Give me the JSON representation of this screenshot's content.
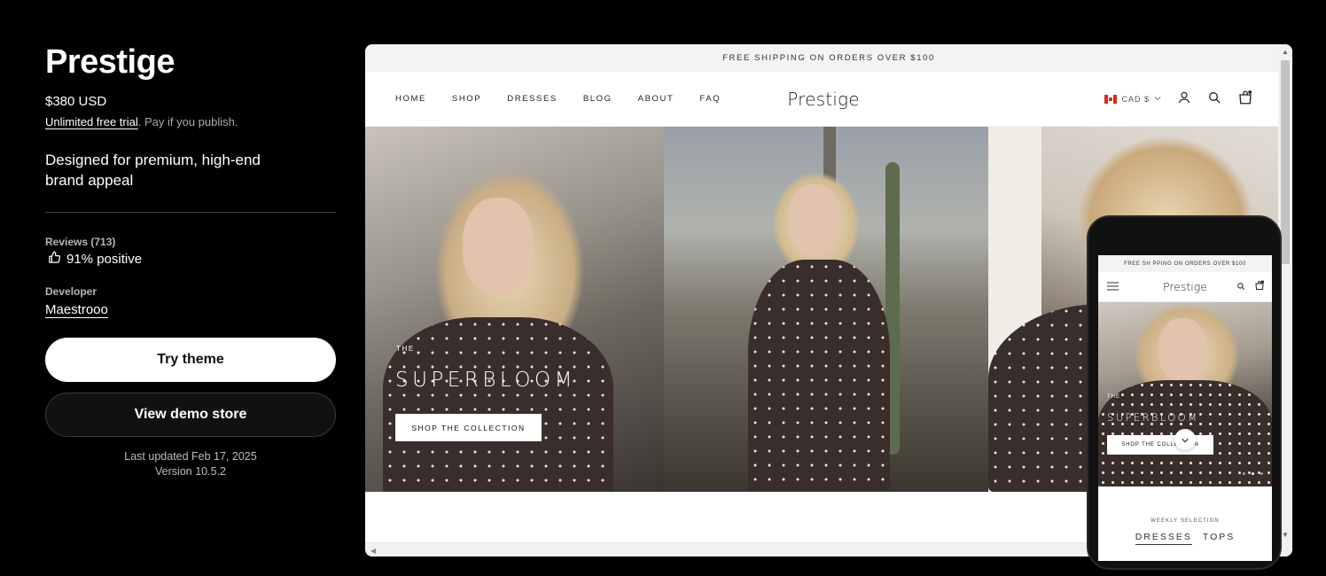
{
  "theme": {
    "name": "Prestige",
    "price": "$380 USD",
    "trial_link": "Unlimited free trial",
    "trial_suffix": ". Pay if you publish.",
    "tagline": "Designed for premium, high-end brand appeal",
    "reviews_label": "Reviews (713)",
    "positive": "91% positive",
    "developer_label": "Developer",
    "developer_name": "Maestrooo",
    "try_button": "Try theme",
    "demo_button": "View demo store",
    "last_updated": "Last updated Feb 17, 2025",
    "version": "Version 10.5.2"
  },
  "store": {
    "announcement": "FREE SHIPPING ON ORDERS OVER $100",
    "nav": [
      "HOME",
      "SHOP",
      "DRESSES",
      "BLOG",
      "ABOUT",
      "FAQ"
    ],
    "logo": "Prestige",
    "currency": "CAD $",
    "hero": {
      "subtitle": "THE",
      "title": "SUPERBLOOM",
      "button": "SHOP THE COLLECTION"
    }
  },
  "mobile": {
    "announcement": "FREE SH PPING ON ORDERS OVER $100",
    "logo": "Prestige",
    "hero_subtitle": "THE",
    "hero_title": "SUPERBLOOM",
    "hero_button": "SHOP THE COLLECTION",
    "section_label": "WEEKLY SELECTION",
    "tabs": [
      "DRESSES",
      "TOPS"
    ]
  },
  "icons": {
    "thumbs_up": "thumbs-up-icon",
    "account": "account-icon",
    "search": "search-icon",
    "cart": "cart-icon",
    "menu": "hamburger-icon",
    "chevron": "chevron-down-icon",
    "flag": "canada-flag-icon"
  },
  "colors": {
    "background": "#000000",
    "primary_button": "#ffffff",
    "secondary_button": "#111111",
    "flag_red": "#d52b1e"
  }
}
